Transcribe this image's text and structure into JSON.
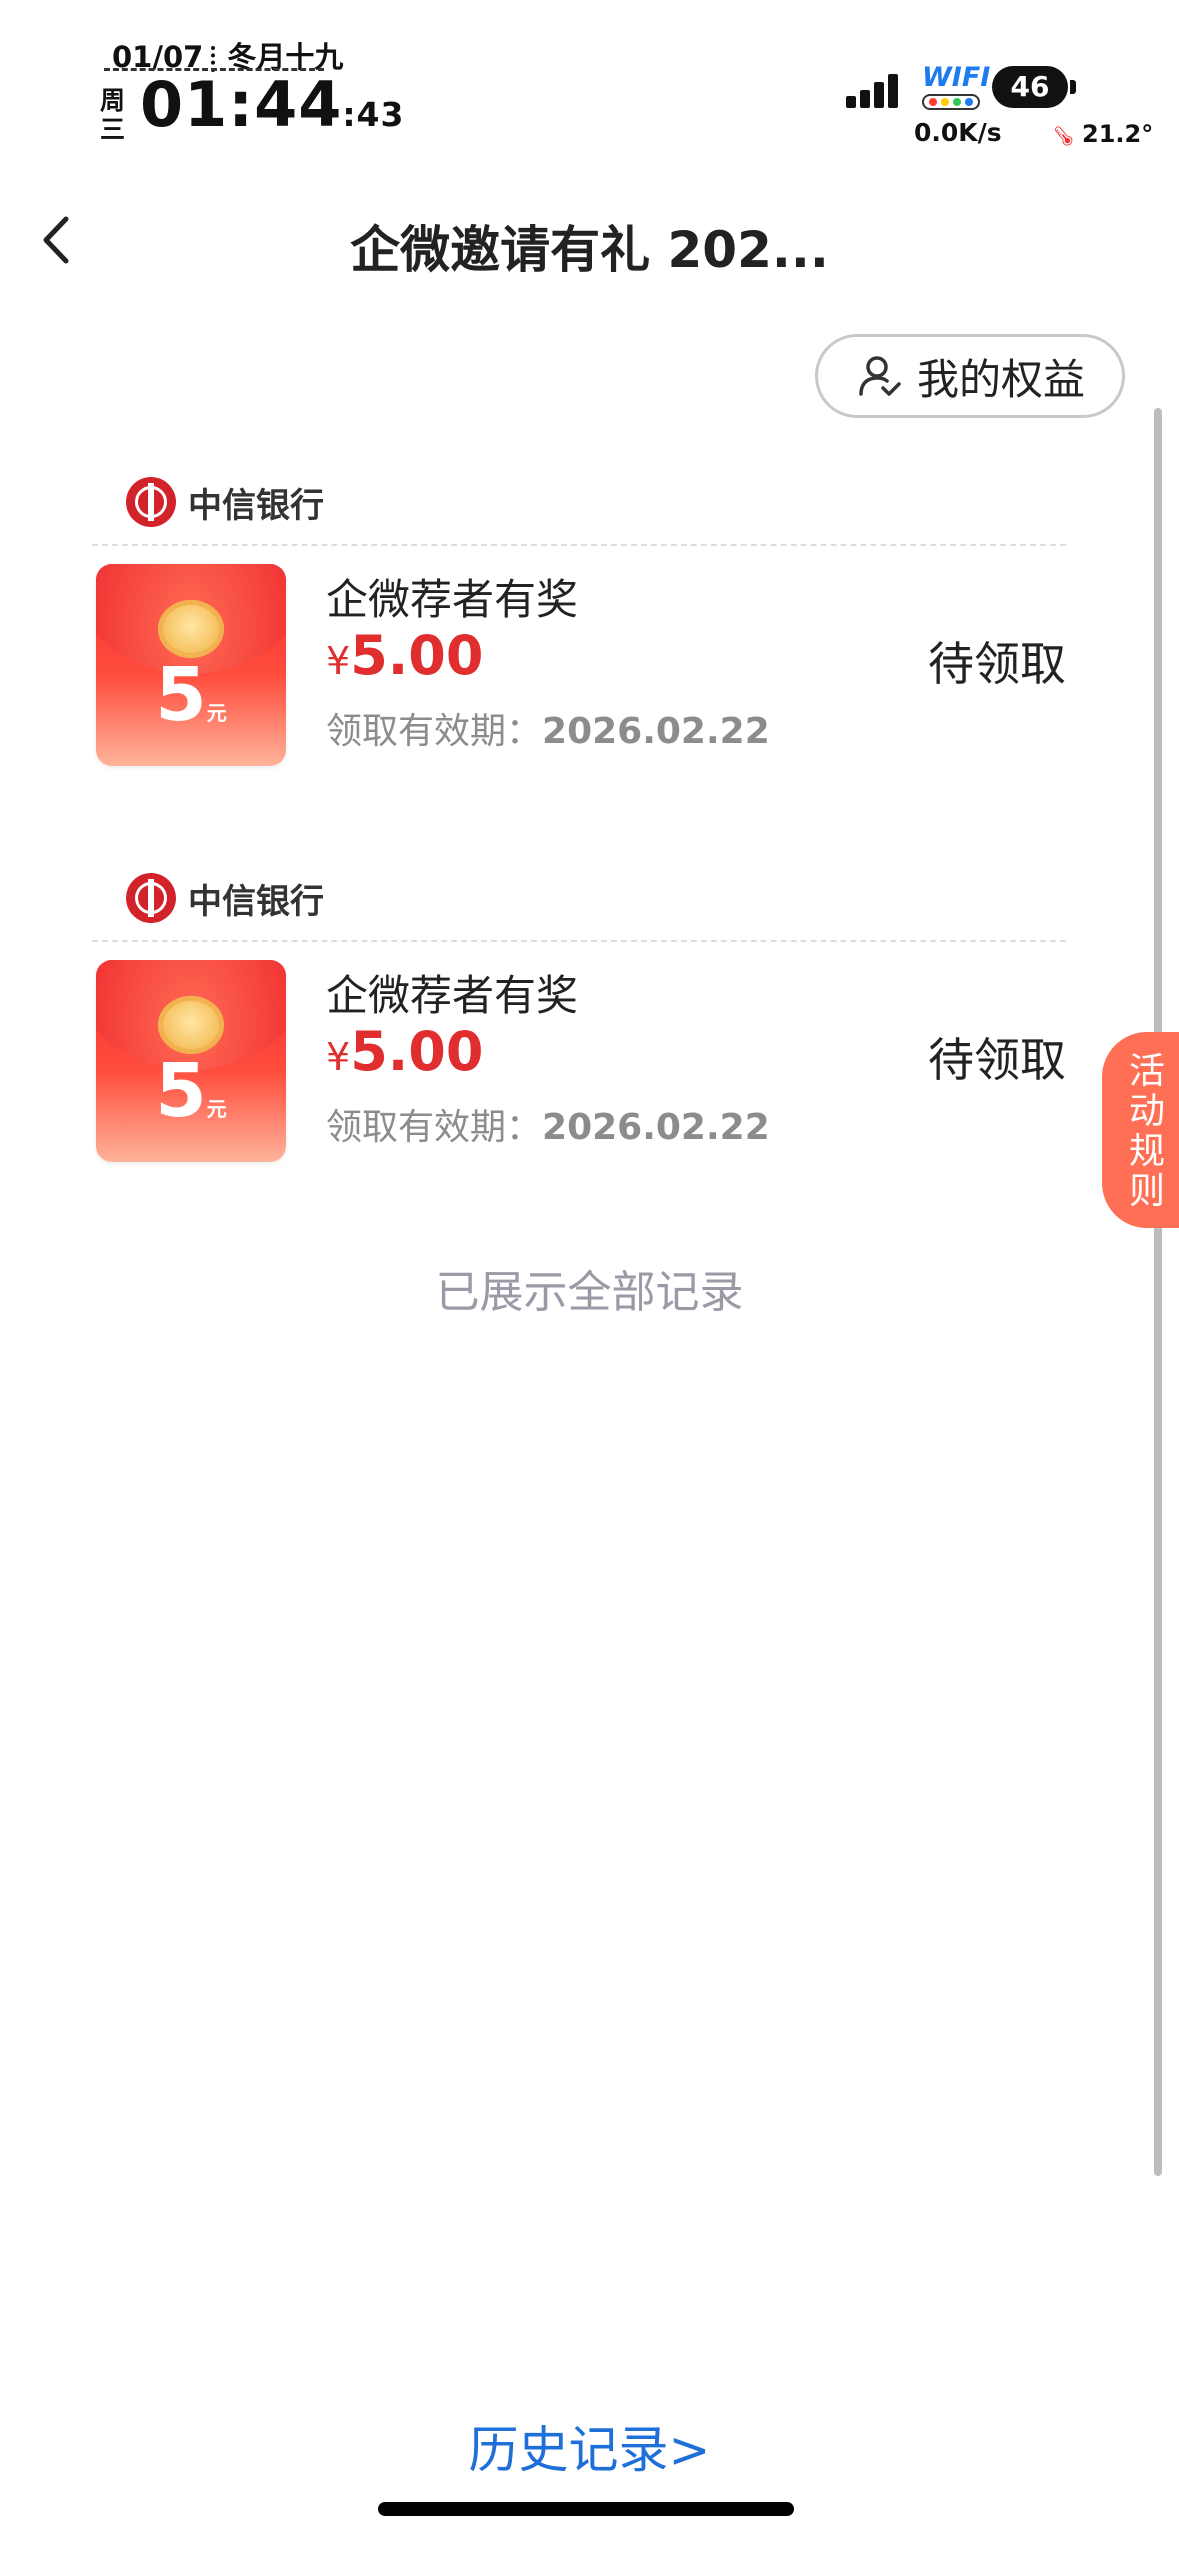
{
  "status_bar": {
    "date": "01/07",
    "lunar": "冬月十九",
    "weekday": "周三",
    "time": "01:44",
    "seconds": ":43",
    "wifi_label": "WIFI",
    "battery": "46",
    "net_speed": "0.0K/s",
    "temperature": "21.2°"
  },
  "header": {
    "title": "企微邀请有礼 202..."
  },
  "rights_button": {
    "label": "我的权益"
  },
  "rewards": [
    {
      "bank": "中信银行",
      "envelope_amount": "5",
      "envelope_unit": "元",
      "title": "企微荐者有奖",
      "currency": "¥",
      "amount": "5.00",
      "expiry_label": "领取有效期：",
      "expiry_date": "2026.02.22",
      "status": "待领取"
    },
    {
      "bank": "中信银行",
      "envelope_amount": "5",
      "envelope_unit": "元",
      "title": "企微荐者有奖",
      "currency": "¥",
      "amount": "5.00",
      "expiry_label": "领取有效期：",
      "expiry_date": "2026.02.22",
      "status": "待领取"
    }
  ],
  "end_note": "已展示全部记录",
  "rules_tab": {
    "label": "活动规则"
  },
  "history_link": "历史记录>",
  "colors": {
    "accent_red": "#e02d2d",
    "link_blue": "#1f6fd8",
    "rules_tab": "#ff6f55"
  }
}
